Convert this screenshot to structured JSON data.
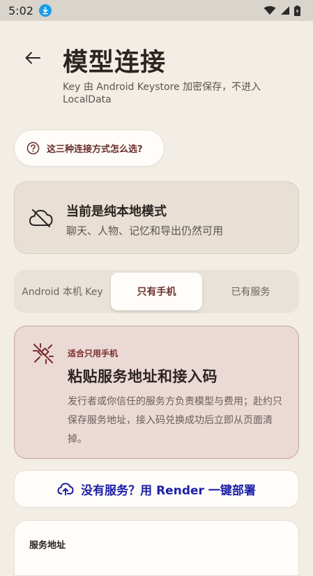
{
  "status_bar": {
    "time": "5:02"
  },
  "header": {
    "title": "模型连接",
    "subtitle": "Key 由 Android Keystore 加密保存，不进入 LocalData"
  },
  "help": {
    "label": "这三种连接方式怎么选?"
  },
  "mode": {
    "title": "当前是纯本地模式",
    "description": "聊天、人物、记忆和导出仍然可用"
  },
  "tabs": [
    {
      "label": "Android 本机 Key"
    },
    {
      "label": "只有手机"
    },
    {
      "label": "已有服务"
    }
  ],
  "selected_tab": "只有手机",
  "option": {
    "kicker": "适合只用手机",
    "title": "粘贴服务地址和接入码",
    "description": "发行者或你信任的服务方负责模型与费用；赴约只保存服务地址，接入码兑换成功后立即从页面清掉。"
  },
  "deploy": {
    "label": "没有服务？用 Render 一键部署"
  },
  "service": {
    "label": "服务地址"
  },
  "colors": {
    "background": "#f2ede5",
    "accent": "#6a2f2b",
    "link": "#1c1fa8",
    "option_card": "#ead9d5"
  },
  "icons": [
    "download-icon",
    "wifi-icon",
    "signal-icon",
    "battery-icon",
    "back-arrow-icon",
    "help-circle-icon",
    "cloud-off-icon",
    "unplug-icon",
    "cloud-upload-icon"
  ]
}
